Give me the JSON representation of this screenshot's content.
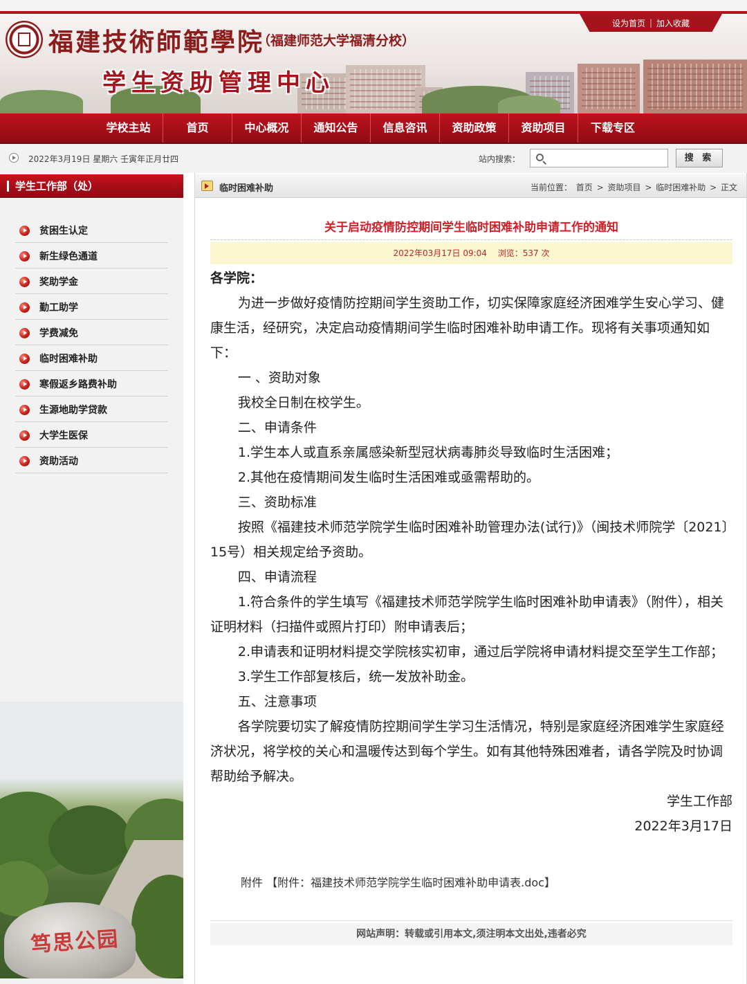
{
  "header": {
    "school_name": "福建技術師範學院",
    "school_sub": "（福建师范大学福清分校）",
    "center_name": "学生资助管理中心",
    "links": [
      "设为首页",
      "加入收藏"
    ]
  },
  "nav": {
    "items": [
      "学校主站",
      "首页",
      "中心概况",
      "通知公告",
      "信息咨讯",
      "资助政策",
      "资助项目",
      "下载专区"
    ]
  },
  "infobar": {
    "date": "2022年3月19日  星期六  壬寅年正月廿四",
    "search_label": "站内搜索：",
    "search_placeholder": "",
    "search_button": "搜 索"
  },
  "sidebar": {
    "title": "学生工作部（处）",
    "items": [
      "贫困生认定",
      "新生绿色通道",
      "奖助学金",
      "勤工助学",
      "学费减免",
      "临时困难补助",
      "寒假返乡路费补助",
      "生源地助学贷款",
      "大学生医保",
      "资助活动"
    ],
    "photo_caption": "笃思公园"
  },
  "main": {
    "section_title": "临时困难补助",
    "breadcrumb": {
      "prefix": "当前位置：",
      "items": [
        "首页",
        "资助项目",
        "临时困难补助",
        "正文"
      ],
      "separator": ">"
    },
    "article": {
      "title": "关于启动疫情防控期间学生临时困难补助申请工作的通知",
      "datetime": "2022年03月17日 09:04",
      "views": "浏览：537 次",
      "salutation": "各学院：",
      "paragraphs": [
        "为进一步做好疫情防控期间学生资助工作，切实保障家庭经济困难学生安心学习、健康生活，经研究，决定启动疫情期间学生临时困难补助申请工作。现将有关事项通知如下：",
        "一 、资助对象",
        "我校全日制在校学生。",
        "二、申请条件",
        "1.学生本人或直系亲属感染新型冠状病毒肺炎导致临时生活困难；",
        "2.其他在疫情期间发生临时生活困难或亟需帮助的。",
        "三、资助标准",
        "按照《福建技术师范学院学生临时困难补助管理办法(试行)》（闽技术师院学〔2021〕15号）相关规定给予资助。",
        "四、申请流程",
        "1.符合条件的学生填写《福建技术师范学院学生临时困难补助申请表》（附件），相关证明材料（扫描件或照片打印）附申请表后；",
        "2.申请表和证明材料提交学院核实初审，通过后学院将申请材料提交至学生工作部；",
        "3.学生工作部复核后，统一发放补助金。",
        "五、注意事项",
        "各学院要切实了解疫情防控期间学生学习生活情况，特别是家庭经济困难学生家庭经济状况，将学校的关心和温暖传达到每个学生。如有其他特殊困难者，请各学院及时协调帮助给予解决。"
      ],
      "signature": "学生工作部",
      "sign_date": "2022年3月17日",
      "attachment_prefix": "附件",
      "attachment_link": "【附件：福建技术师范学院学生临时困难补助申请表.doc】"
    },
    "statement": "网站声明：转载或引用本文,须注明本文出处,违者必究"
  },
  "colors": {
    "brand_red": "#b5121b",
    "title_red": "#d0202a",
    "meta_bg": "#fbf7d0"
  }
}
